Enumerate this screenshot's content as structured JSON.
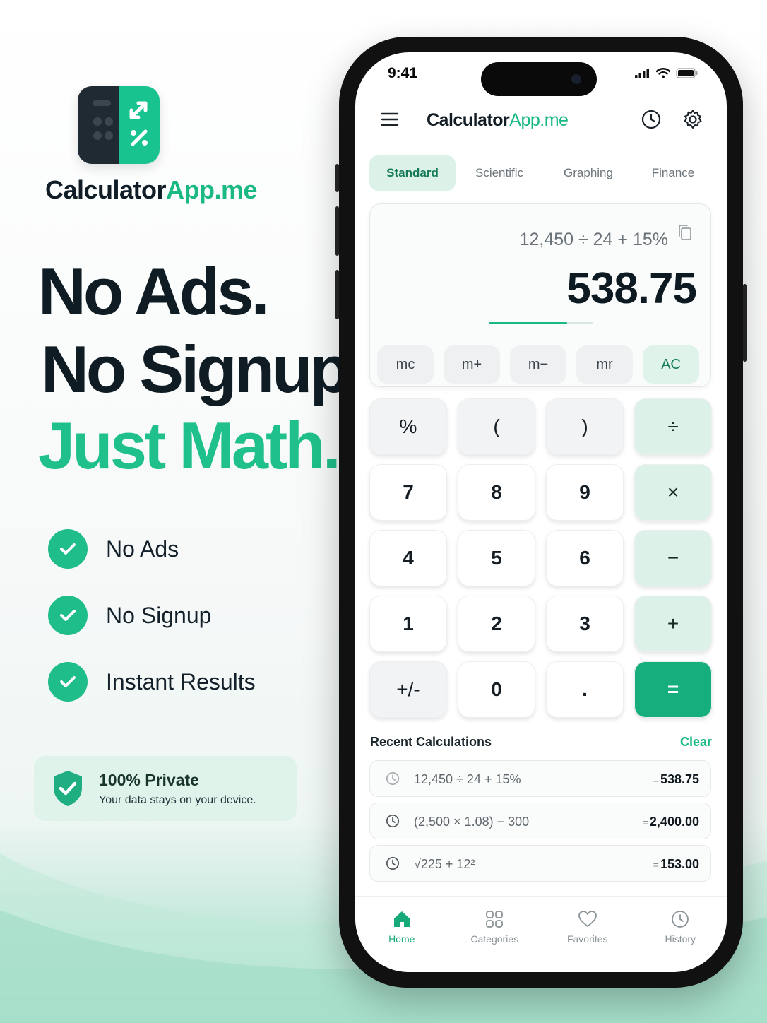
{
  "brand": {
    "name_dark": "Calculator",
    "name_green": "App.me"
  },
  "headline": {
    "line1": "No Ads.",
    "line2": "No Signup.",
    "line3": "Just Math."
  },
  "features": [
    "No Ads",
    "No Signup",
    "Instant Results"
  ],
  "privacy": {
    "title": "100% Private",
    "subtitle": "Your data stays on your device."
  },
  "status_bar": {
    "time": "9:41"
  },
  "app_header": {
    "title_dark": "Calculator",
    "title_green": "App.me"
  },
  "tabs": [
    {
      "label": "Standard",
      "active": true
    },
    {
      "label": "Scientific",
      "active": false
    },
    {
      "label": "Graphing",
      "active": false
    },
    {
      "label": "Finance",
      "active": false
    }
  ],
  "display": {
    "expression": "12,450 ÷ 24 + 15%",
    "result": "538.75",
    "progress": 0.75
  },
  "memory_buttons": [
    "mc",
    "m+",
    "m−",
    "mr",
    "AC"
  ],
  "keypad": [
    [
      "%",
      "(",
      ")",
      "÷"
    ],
    [
      "7",
      "8",
      "9",
      "×"
    ],
    [
      "4",
      "5",
      "6",
      "−"
    ],
    [
      "1",
      "2",
      "3",
      "+"
    ],
    [
      "+/-",
      "0",
      ".",
      "="
    ]
  ],
  "recent": {
    "title": "Recent Calculations",
    "clear_label": "Clear",
    "items": [
      {
        "expression": "12,450 ÷ 24 + 15%",
        "result": "538.75"
      },
      {
        "expression": "(2,500 × 1.08) − 300",
        "result": "2,400.00"
      },
      {
        "expression": "√225 + 12²",
        "result": "153.00"
      }
    ]
  },
  "bottom_nav": [
    {
      "label": "Home",
      "icon": "home-icon",
      "active": true
    },
    {
      "label": "Categories",
      "icon": "grid-icon",
      "active": false
    },
    {
      "label": "Favorites",
      "icon": "heart-icon",
      "active": false
    },
    {
      "label": "History",
      "icon": "history-icon",
      "active": false
    }
  ],
  "colors": {
    "accent": "#19b884",
    "dark": "#0f1c24",
    "equals": "#17ae7d",
    "operator_bg": "#dcf1e7"
  }
}
